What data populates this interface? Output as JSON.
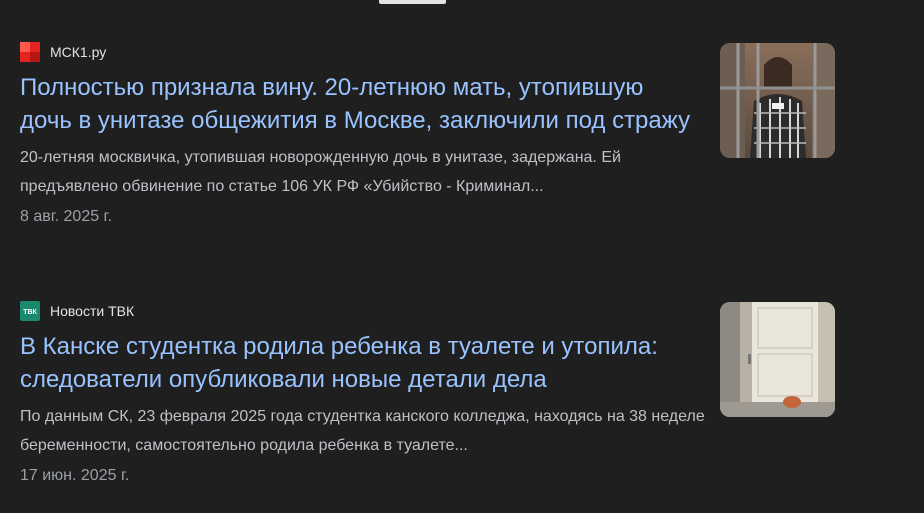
{
  "articles": [
    {
      "source": "МСК1.ру",
      "headline": "Полностью признала вину. 20-летнюю мать, утопившую дочь в унитазе общежития в Москве, заключили под стражу",
      "snippet": "20-летняя москвичка, утопившая новорожденную дочь в унитазе, задержана. Ей предъявлено обвинение по статье 106 УК РФ «Убийство - Криминал...",
      "date": "8 авг. 2025 г.",
      "favicon_color": "#e5231f"
    },
    {
      "source": "Новости ТВК",
      "headline": "В Канске студентка родила ребенка в туалете и утопила: следователи опубликовали новые детали дела",
      "snippet": "По данным СК, 23 февраля 2025 года студентка канского колледжа, находясь на 38 неделе беременности, самостоятельно родила ребенка в туалете...",
      "date": "17 июн. 2025 г.",
      "favicon_color": "#1a8a6e",
      "favicon_text": "ТВК"
    }
  ],
  "colors": {
    "background": "#1f1f1f",
    "headline": "#99c3ff",
    "snippet": "#bdc1c6",
    "date": "#9aa0a6"
  }
}
